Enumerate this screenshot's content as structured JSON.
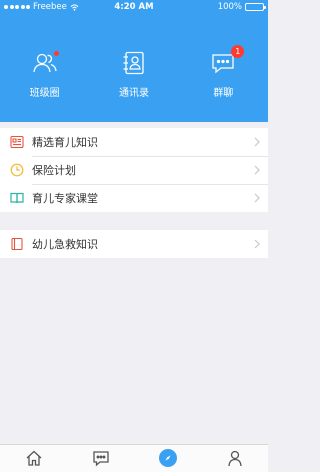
{
  "status_bar": {
    "carrier": "Freebee",
    "time": "4:20 AM",
    "battery": "100%"
  },
  "shortcuts": [
    {
      "label": "班级圈",
      "icon": "class-circle-icon",
      "has_dot": true
    },
    {
      "label": "通讯录",
      "icon": "contacts-icon"
    },
    {
      "label": "群聊",
      "icon": "group-chat-icon",
      "badge": "1"
    }
  ],
  "list_group_1": [
    {
      "label": "精选育儿知识",
      "icon": "article-icon",
      "icon_color": "#e8553c"
    },
    {
      "label": "保险计划",
      "icon": "clock-icon",
      "icon_color": "#f5b82e"
    },
    {
      "label": "育儿专家课堂",
      "icon": "book-icon",
      "icon_color": "#2bb3a5"
    }
  ],
  "list_group_2": [
    {
      "label": "幼儿急救知识",
      "icon": "notebook-icon",
      "icon_color": "#e8553c"
    }
  ],
  "tabbar": {
    "tabs": [
      {
        "icon": "home-icon",
        "active": false
      },
      {
        "icon": "message-icon",
        "active": false
      },
      {
        "icon": "discover-icon",
        "active": true
      },
      {
        "icon": "profile-icon",
        "active": false
      }
    ]
  },
  "colors": {
    "header_bg": "#3aa1f2",
    "badge": "#ff3b30",
    "background": "#efeff4"
  }
}
